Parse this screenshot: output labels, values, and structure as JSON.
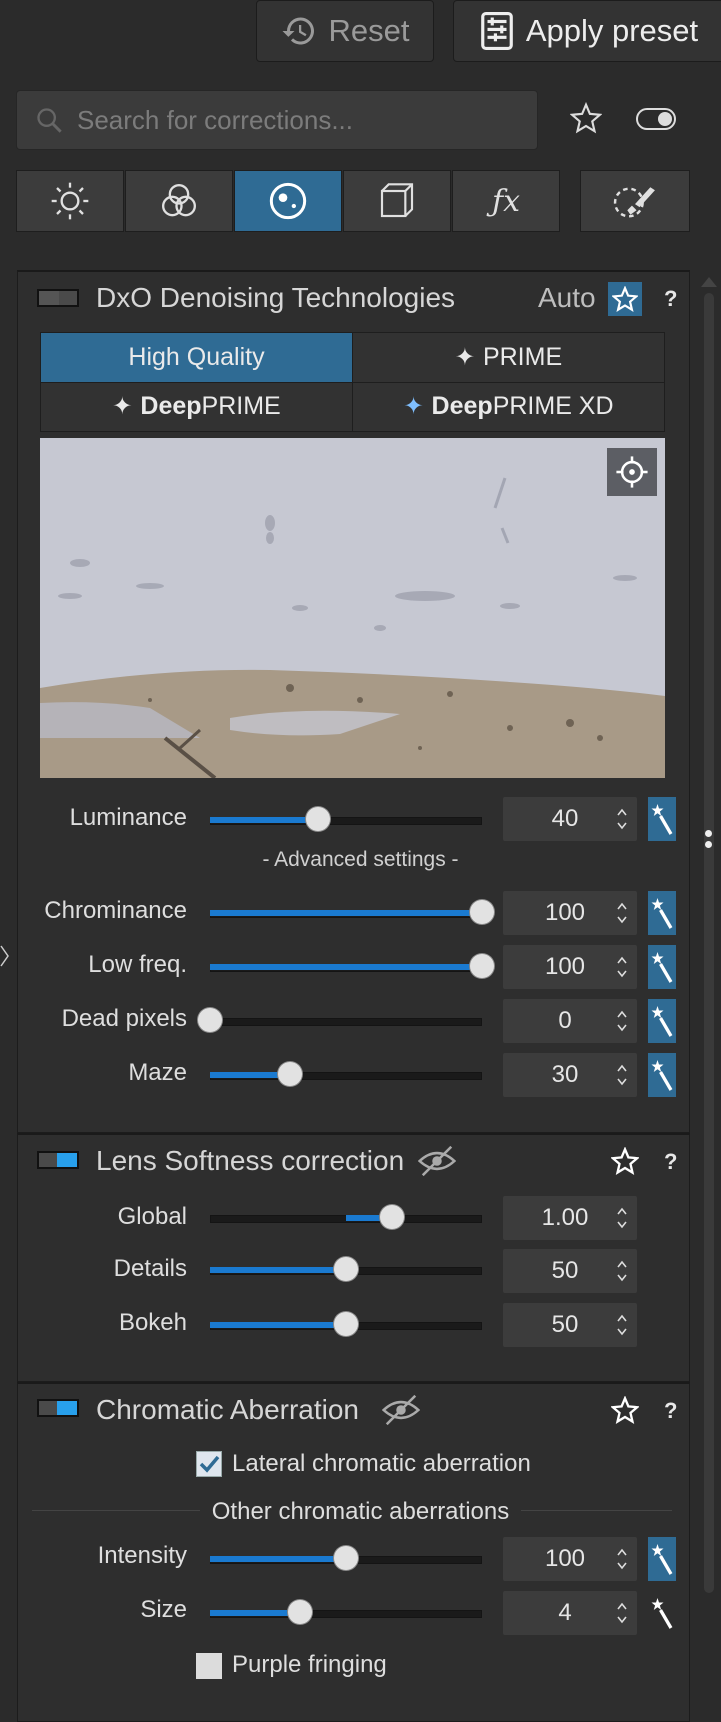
{
  "header": {
    "reset_label": "Reset",
    "apply_label": "Apply preset"
  },
  "search": {
    "placeholder": "Search for corrections..."
  },
  "tabs": [
    {
      "icon": "sun-icon"
    },
    {
      "icon": "color-circles-icon"
    },
    {
      "icon": "lens-icon",
      "active": true
    },
    {
      "icon": "cube-icon"
    },
    {
      "icon": "fx-icon"
    },
    {
      "icon": "local-adjust-brush-icon"
    }
  ],
  "denoise": {
    "title": "DxO Denoising Technologies",
    "auto_label": "Auto",
    "help": "?",
    "modes": {
      "high_quality": "High Quality",
      "prime": "PRIME",
      "deep_bold": "Deep",
      "deep_rest": "PRIME",
      "deepxd_bold": "Deep",
      "deepxd_rest": "PRIME XD"
    },
    "luminance_label": "Luminance",
    "luminance_value": "40",
    "advanced_label": "- Advanced settings -",
    "chrominance_label": "Chrominance",
    "chrominance_value": "100",
    "lowfreq_label": "Low freq.",
    "lowfreq_value": "100",
    "deadpixels_label": "Dead pixels",
    "deadpixels_value": "0",
    "maze_label": "Maze",
    "maze_value": "30"
  },
  "softness": {
    "title": "Lens Softness correction",
    "help": "?",
    "global_label": "Global",
    "global_value": "1.00",
    "details_label": "Details",
    "details_value": "50",
    "bokeh_label": "Bokeh",
    "bokeh_value": "50"
  },
  "chromatic": {
    "title": "Chromatic Aberration",
    "help": "?",
    "lateral_label": "Lateral chromatic aberration",
    "lateral_checked": true,
    "other_label": "Other chromatic aberrations",
    "intensity_label": "Intensity",
    "intensity_value": "100",
    "size_label": "Size",
    "size_value": "4",
    "purple_label": "Purple fringing",
    "purple_checked": false
  },
  "colors": {
    "accent": "#2f6b94",
    "slider_fill": "#1a7ad0",
    "toggle_on": "#28a0ec"
  }
}
